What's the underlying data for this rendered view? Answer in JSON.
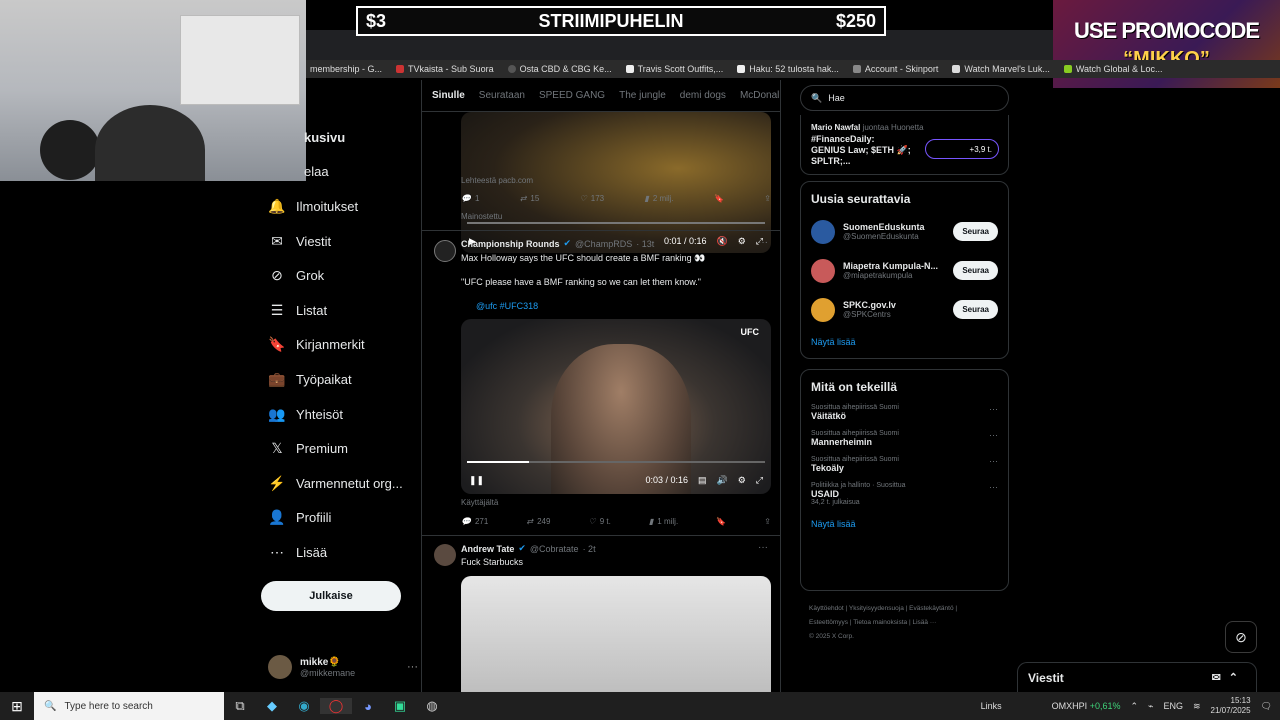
{
  "overlay": {
    "left": "$3",
    "title": "STRIIMIPUHELIN",
    "right": "$250"
  },
  "promo": {
    "line1": "USE PROMOCODE",
    "line2": "“MIKKO”"
  },
  "bookmarks": [
    "membership - G...",
    "TVkaista - Sub Suora",
    "Osta CBD & CBG Ke...",
    "Travis Scott Outfits,...",
    "Haku: 52 tulosta hak...",
    "Account - Skinport",
    "Watch Marvel's Luk...",
    "Watch Global & Loc..."
  ],
  "nav": {
    "partial_top1": "kusivu",
    "partial_top2": "elaa",
    "items": [
      {
        "label": "Ilmoitukset",
        "icon": "bell-icon",
        "glyph": "🔔"
      },
      {
        "label": "Viestit",
        "icon": "mail-icon",
        "glyph": "✉"
      },
      {
        "label": "Grok",
        "icon": "grok-icon",
        "glyph": "⊘"
      },
      {
        "label": "Listat",
        "icon": "list-icon",
        "glyph": "☰"
      },
      {
        "label": "Kirjanmerkit",
        "icon": "bookmark-icon",
        "glyph": "🔖"
      },
      {
        "label": "Työpaikat",
        "icon": "briefcase-icon",
        "glyph": "💼"
      },
      {
        "label": "Yhteisöt",
        "icon": "communities-icon",
        "glyph": "👥"
      },
      {
        "label": "Premium",
        "icon": "x-logo-icon",
        "glyph": "𝕏"
      },
      {
        "label": "Varmennetut org...",
        "icon": "lightning-icon",
        "glyph": "⚡"
      },
      {
        "label": "Profiili",
        "icon": "person-icon",
        "glyph": "👤"
      },
      {
        "label": "Lisää",
        "icon": "more-circle-icon",
        "glyph": "⋯"
      }
    ],
    "post_label": "Julkaise"
  },
  "profile": {
    "name": "mikke🌻",
    "handle": "@mikkemane",
    "more": "···"
  },
  "feed": {
    "tabs": [
      "Sinulle",
      "Seurataan",
      "SPEED GANG",
      "The jungle",
      "demi dogs",
      "McDonal"
    ],
    "tweet1": {
      "time": "0:01 / 0:16",
      "source": "Lehteestä pacb.com",
      "replies": "1",
      "retweets": "15",
      "likes": "173",
      "views": "2 milj.",
      "promoted": "Mainostettu"
    },
    "tweet2": {
      "name": "Championship Rounds",
      "handle": "@ChampRDS",
      "time_ago": "· 13t",
      "text1": "Max Holloway says the UFC should create a BMF ranking 👀",
      "text2": "\"UFC please have a BMF ranking so we can let them know.\"",
      "tags": "@ufc #UFC318",
      "video_logo": "UFC",
      "video_time": "0:03 / 0:16",
      "source": "Käyttäjältä",
      "replies": "271",
      "retweets": "249",
      "likes": "9 t.",
      "views": "1 milj."
    },
    "tweet3": {
      "name": "Andrew Tate",
      "handle": "@Cobratate",
      "time_ago": "· 2t",
      "text": "Fuck Starbucks"
    }
  },
  "search": {
    "value": "Hae"
  },
  "top_card": {
    "name": "Mario Nawfal",
    "sub": "juontaa Huonetta",
    "text": "#FinanceDaily: GENIUS Law; $ETH 🚀; SPLTR;...",
    "badge": "+3,9 t."
  },
  "who_to_follow": {
    "title": "Uusia seurattavia",
    "users": [
      {
        "name": "SuomenEduskunta",
        "handle": "@SuomenEduskunta",
        "button": "Seuraa",
        "color": "#2a5aa0"
      },
      {
        "name": "Miapetra Kumpula-N...",
        "handle": "@miapetrakumpula",
        "button": "Seuraa",
        "color": "#c85a5a"
      },
      {
        "name": "SPKC.gov.lv",
        "handle": "@SPKCentrs",
        "button": "Seuraa",
        "color": "#e0a030"
      }
    ],
    "more": "Näytä lisää"
  },
  "trends": {
    "title": "Mitä on tekeillä",
    "items": [
      {
        "context": "Suosittua aihepiirissä Suomi",
        "title": "Väitätkö",
        "count": ""
      },
      {
        "context": "Suosittua aihepiirissä Suomi",
        "title": "Mannerheimin",
        "count": ""
      },
      {
        "context": "Suosittua aihepiirissä Suomi",
        "title": "Tekoäly",
        "count": ""
      },
      {
        "context": "Politiikka ja hallinto · Suosittua",
        "title": "USAID",
        "count": "34,2 t. julkaisua"
      }
    ],
    "more": "Näytä lisää"
  },
  "footer": [
    "Käyttöehdot",
    "Yksityisyydensuoja",
    "Evästekäytäntö",
    "Esteettömyys",
    "Tietoa mainoksista",
    "Lisää ···",
    "© 2025 X Corp."
  ],
  "messages_dock": {
    "title": "Viestit"
  },
  "taskbar": {
    "search_placeholder": "Type here to search",
    "links": "Links",
    "ticker": "OMXHPI",
    "ticker_change": "+0,61%",
    "lang": "ENG",
    "time": "15:13",
    "date": "21/07/2025"
  }
}
